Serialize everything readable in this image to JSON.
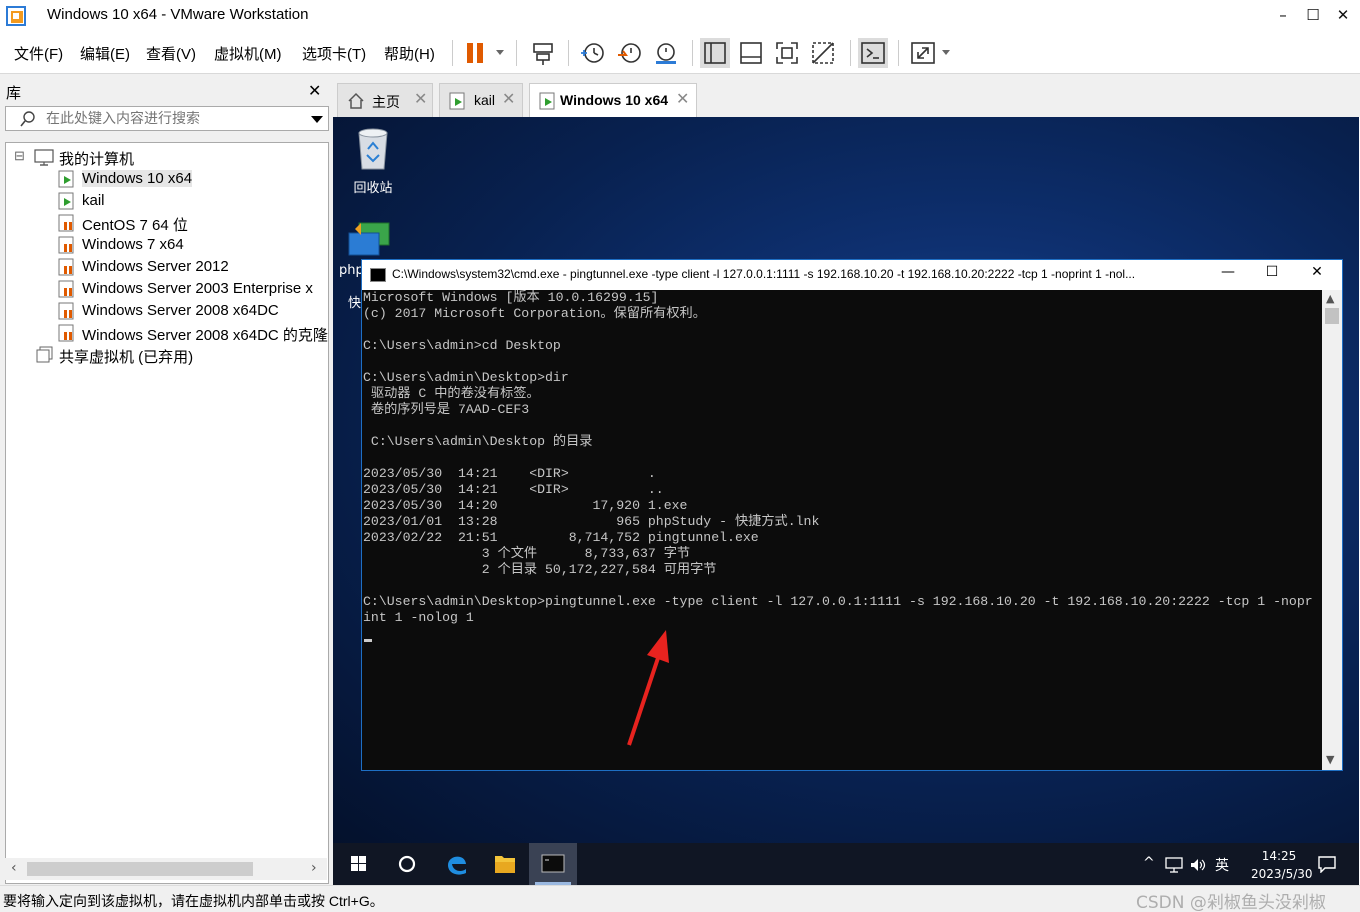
{
  "window": {
    "title": "Windows 10 x64 - VMware Workstation",
    "minimize": "–",
    "maximize": "☐",
    "close": "✕"
  },
  "menu": {
    "items": [
      "文件(F)",
      "编辑(E)",
      "查看(V)",
      "虚拟机(M)",
      "选项卡(T)",
      "帮助(H)"
    ]
  },
  "toolbar": {
    "icons": [
      "pause-icon",
      "send-ctrl-alt-del-icon",
      "snapshot-icon",
      "revert-snapshot-icon",
      "snapshot-manager-icon",
      "library-view-icon",
      "thumbnail-view-icon",
      "fullscreen-icon",
      "unity-icon",
      "console-icon",
      "stretch-icon"
    ],
    "accent_color": "#e05a00"
  },
  "library": {
    "title": "库",
    "close": "✕",
    "search_placeholder": "在此处键入内容进行搜索",
    "root": "我的计算机",
    "expander": "⊟",
    "vms": [
      {
        "label": "Windows 10 x64",
        "running": true,
        "selected": true
      },
      {
        "label": "kail",
        "running": true,
        "selected": false
      },
      {
        "label": "CentOS 7 64 位",
        "running": false,
        "selected": false
      },
      {
        "label": "Windows 7 x64",
        "running": false,
        "selected": false
      },
      {
        "label": "Windows Server 2012",
        "running": false,
        "selected": false
      },
      {
        "label": "Windows Server 2003 Enterprise x",
        "running": false,
        "selected": false
      },
      {
        "label": "Windows Server 2008 x64DC",
        "running": false,
        "selected": false
      },
      {
        "label": "Windows Server 2008 x64DC 的克隆",
        "running": false,
        "selected": false
      }
    ],
    "shared": "共享虚拟机 (已弃用)"
  },
  "tabs": [
    {
      "label": "主页",
      "icon": "home-icon",
      "active": false
    },
    {
      "label": "kail",
      "icon": "vm-running-icon",
      "active": false
    },
    {
      "label": "Windows 10 x64",
      "icon": "vm-running-icon",
      "active": true
    }
  ],
  "tab_close": "✕",
  "desktop": {
    "icons": [
      {
        "label": "回收站",
        "icon": "recycle-bin-icon"
      },
      {
        "label": "php",
        "icon": "phpstudy-icon"
      }
    ],
    "partial_label": "快"
  },
  "cmd": {
    "title": "C:\\Windows\\system32\\cmd.exe - pingtunnel.exe  -type client -l 127.0.0.1:1111 -s 192.168.10.20 -t 192.168.10.20:2222 -tcp 1 -noprint 1 -nol...",
    "minimize": "—",
    "maximize": "☐",
    "close": "✕",
    "lines": [
      "Microsoft Windows [版本 10.0.16299.15]",
      "(c) 2017 Microsoft Corporation。保留所有权利。",
      "",
      "C:\\Users\\admin>cd Desktop",
      "",
      "C:\\Users\\admin\\Desktop>dir",
      " 驱动器 C 中的卷没有标签。",
      " 卷的序列号是 7AAD-CEF3",
      "",
      " C:\\Users\\admin\\Desktop 的目录",
      "",
      "2023/05/30  14:21    <DIR>          .",
      "2023/05/30  14:21    <DIR>          ..",
      "2023/05/30  14:20            17,920 1.exe",
      "2023/01/01  13:28               965 phpStudy - 快捷方式.lnk",
      "2023/02/22  21:51         8,714,752 pingtunnel.exe",
      "               3 个文件      8,733,637 字节",
      "               2 个目录 50,172,227,584 可用字节",
      "",
      "C:\\Users\\admin\\Desktop>pingtunnel.exe -type client -l 127.0.0.1:1111 -s 192.168.10.20 -t 192.168.10.20:2222 -tcp 1 -nopr",
      "int 1 -nolog 1"
    ],
    "arrow_color": "#e8231f"
  },
  "taskbar": {
    "apps": [
      "windows-start-icon",
      "cortana-icon",
      "edge-icon",
      "file-explorer-icon",
      "cmd-icon"
    ],
    "tray": {
      "chevron": "^",
      "ime": "英",
      "time": "14:25",
      "date": "2023/5/30"
    }
  },
  "statusbar": {
    "text": "要将输入定向到该虚拟机，请在虚拟机内部单击或按 Ctrl+G。",
    "watermark": "CSDN @剁椒鱼头没剁椒"
  }
}
